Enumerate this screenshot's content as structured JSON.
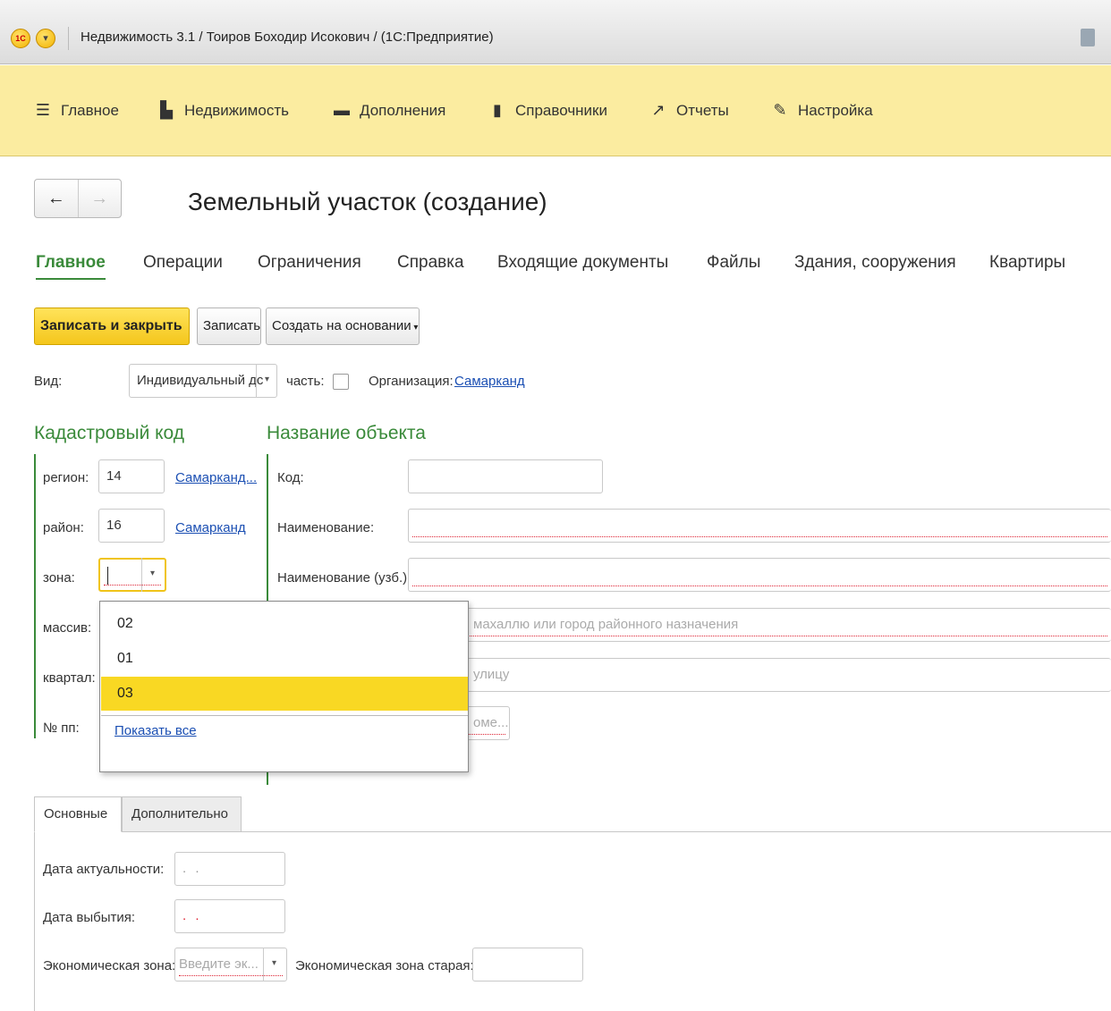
{
  "titlebar": {
    "logo": "1С",
    "title": "Недвижимость 3.1 / Тоиров Боходир Исокович / (1С:Предприятие)"
  },
  "sections": [
    {
      "label": "Главное",
      "icon": "hamburger-menu-icon"
    },
    {
      "label": "Недвижимость",
      "icon": "building-icon"
    },
    {
      "label": "Дополнения",
      "icon": "list-icon"
    },
    {
      "label": "Справочники",
      "icon": "book-icon"
    },
    {
      "label": "Отчеты",
      "icon": "chart-icon"
    },
    {
      "label": "Настройка",
      "icon": "wrench-icon"
    }
  ],
  "page_title": "Земельный участок (создание)",
  "tabs": [
    "Главное",
    "Операции",
    "Ограничения",
    "Справка",
    "Входящие документы",
    "Файлы",
    "Здания, сооружения",
    "Квартиры"
  ],
  "toolbar": {
    "save_close": "Записать и закрыть",
    "save": "Записать",
    "create_based": "Создать на основании"
  },
  "header_row": {
    "vid_label": "Вид:",
    "vid_value": "Индивидуальный дс",
    "part_label": "часть:",
    "org_label": "Организация:",
    "org_value": "Самарканд"
  },
  "cadastral": {
    "heading": "Кадастровый код",
    "region_label": "регион:",
    "region_value": "14",
    "region_link": "Самарканд...",
    "district_label": "район:",
    "district_value": "16",
    "district_link": "Самарканд",
    "zone_label": "зона:",
    "massiv_label": "массив:",
    "kvartal_label": "квартал:",
    "npp_label": "№ пп:"
  },
  "object": {
    "heading": "Название объекта",
    "code_label": "Код:",
    "name_label": "Наименование:",
    "name_uz_label": "Наименование (узб.):",
    "mahalla_placeholder": "махаллю или город районного назначения",
    "street_placeholder": "улицу",
    "partial_button": "оме..."
  },
  "zone_dropdown": {
    "items": [
      "02",
      "01",
      "03"
    ],
    "selected": "03",
    "show_all": "Показать все"
  },
  "lower_tabs": [
    "Основные",
    "Дополнительно"
  ],
  "lower": {
    "date_actual_label": "Дата актуальности:",
    "date_actual_value": ". .",
    "date_exit_label": "Дата выбытия:",
    "date_exit_value": ". .",
    "econ_zone_label": "Экономическая зона:",
    "econ_zone_placeholder": "Введите эк...",
    "econ_zone_old_label": "Экономическая зона старая:"
  }
}
